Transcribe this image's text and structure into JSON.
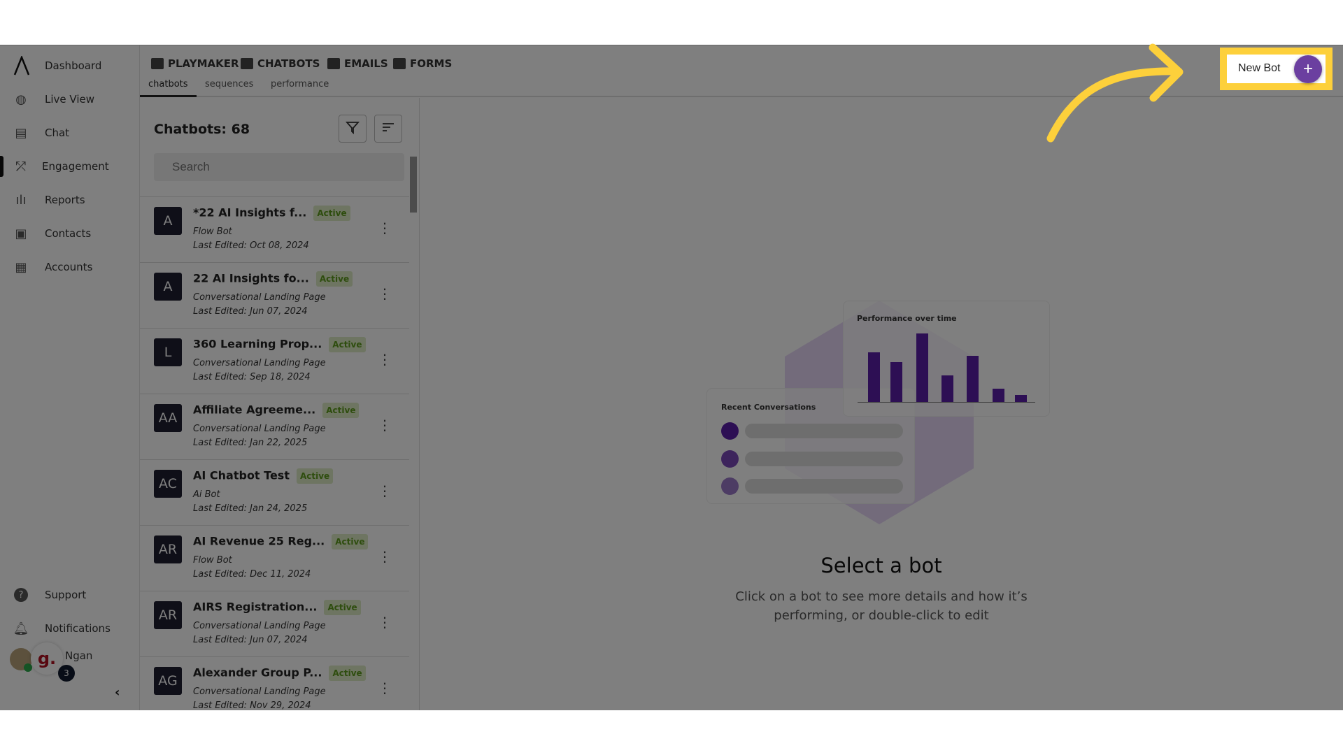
{
  "sidebar": {
    "items": [
      {
        "label": "Dashboard",
        "icon": "logo-icon"
      },
      {
        "label": "Live View",
        "icon": "live-view-icon"
      },
      {
        "label": "Chat",
        "icon": "chat-icon"
      },
      {
        "label": "Engagement",
        "icon": "engagement-icon"
      },
      {
        "label": "Reports",
        "icon": "bar-chart-icon"
      },
      {
        "label": "Contacts",
        "icon": "contacts-icon"
      },
      {
        "label": "Accounts",
        "icon": "building-icon"
      }
    ],
    "active": "Engagement",
    "support": "Support",
    "notifications": "Notifications",
    "user_name": "Ngan",
    "notification_count": "3",
    "org_logo": "g."
  },
  "topnav": {
    "tabs": [
      "PLAYMAKER",
      "CHATBOTS",
      "EMAILS",
      "FORMS"
    ],
    "subtabs": [
      "chatbots",
      "sequences",
      "performance"
    ],
    "active_subtab": "chatbots"
  },
  "list": {
    "title": "Chatbots: 68",
    "search_placeholder": "Search",
    "items": [
      {
        "initials": "A",
        "name": "*22 AI Insights f...",
        "status": "Active",
        "type": "Flow Bot",
        "edited": "Last Edited: Oct 08, 2024"
      },
      {
        "initials": "A",
        "name": "22 AI Insights fo...",
        "status": "Active",
        "type": "Conversational Landing Page",
        "edited": "Last Edited: Jun 07, 2024"
      },
      {
        "initials": "L",
        "name": "360 Learning Prop...",
        "status": "Active",
        "type": "Conversational Landing Page",
        "edited": "Last Edited: Sep 18, 2024"
      },
      {
        "initials": "AA",
        "name": "Affiliate Agreeme...",
        "status": "Active",
        "type": "Conversational Landing Page",
        "edited": "Last Edited: Jan 22, 2025"
      },
      {
        "initials": "AC",
        "name": "AI Chatbot Test",
        "status": "Active",
        "type": "Ai Bot",
        "edited": "Last Edited: Jan 24, 2025"
      },
      {
        "initials": "AR",
        "name": "AI Revenue 25 Reg...",
        "status": "Active",
        "type": "Flow Bot",
        "edited": "Last Edited: Dec 11, 2024"
      },
      {
        "initials": "AR",
        "name": "AIRS Registration...",
        "status": "Active",
        "type": "Conversational Landing Page",
        "edited": "Last Edited: Jun 07, 2024"
      },
      {
        "initials": "AG",
        "name": "Alexander Group P...",
        "status": "Active",
        "type": "Conversational Landing Page",
        "edited": "Last Edited: Nov 29, 2024"
      }
    ]
  },
  "main": {
    "illustration": {
      "performance_title": "Performance over time",
      "recent_title": "Recent Conversations"
    },
    "empty_title": "Select a bot",
    "empty_subtitle": "Click on a bot to see more details and how it’s performing, or double-click to edit"
  },
  "new_bot": {
    "label": "New Bot",
    "icon": "plus-icon"
  },
  "colors": {
    "accent": "#6b3fa0",
    "highlight": "#fdd03b",
    "badge_text": "#5d9a1c",
    "chart_bar": "#5a1fa8"
  }
}
